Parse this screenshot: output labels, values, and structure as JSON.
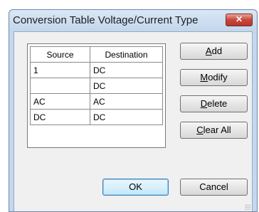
{
  "window": {
    "title": "Conversion Table Voltage/Current Type",
    "close_glyph": "✕"
  },
  "table": {
    "columns": [
      "Source",
      "Destination"
    ],
    "rows": [
      [
        "1",
        "DC"
      ],
      [
        "",
        "DC"
      ],
      [
        "AC",
        "AC"
      ],
      [
        "DC",
        "DC"
      ]
    ]
  },
  "buttons": {
    "add": {
      "mnemonic": "A",
      "rest": "dd"
    },
    "modify": {
      "mnemonic": "M",
      "rest": "odify"
    },
    "delete": {
      "mnemonic": "D",
      "rest": "elete"
    },
    "clear_all": {
      "mnemonic": "C",
      "rest": "lear All"
    },
    "ok": "OK",
    "cancel": "Cancel"
  },
  "colors": {
    "frame": "#c5d7ec",
    "close_button": "#c9463a",
    "default_button_border": "#3c7fb1"
  }
}
